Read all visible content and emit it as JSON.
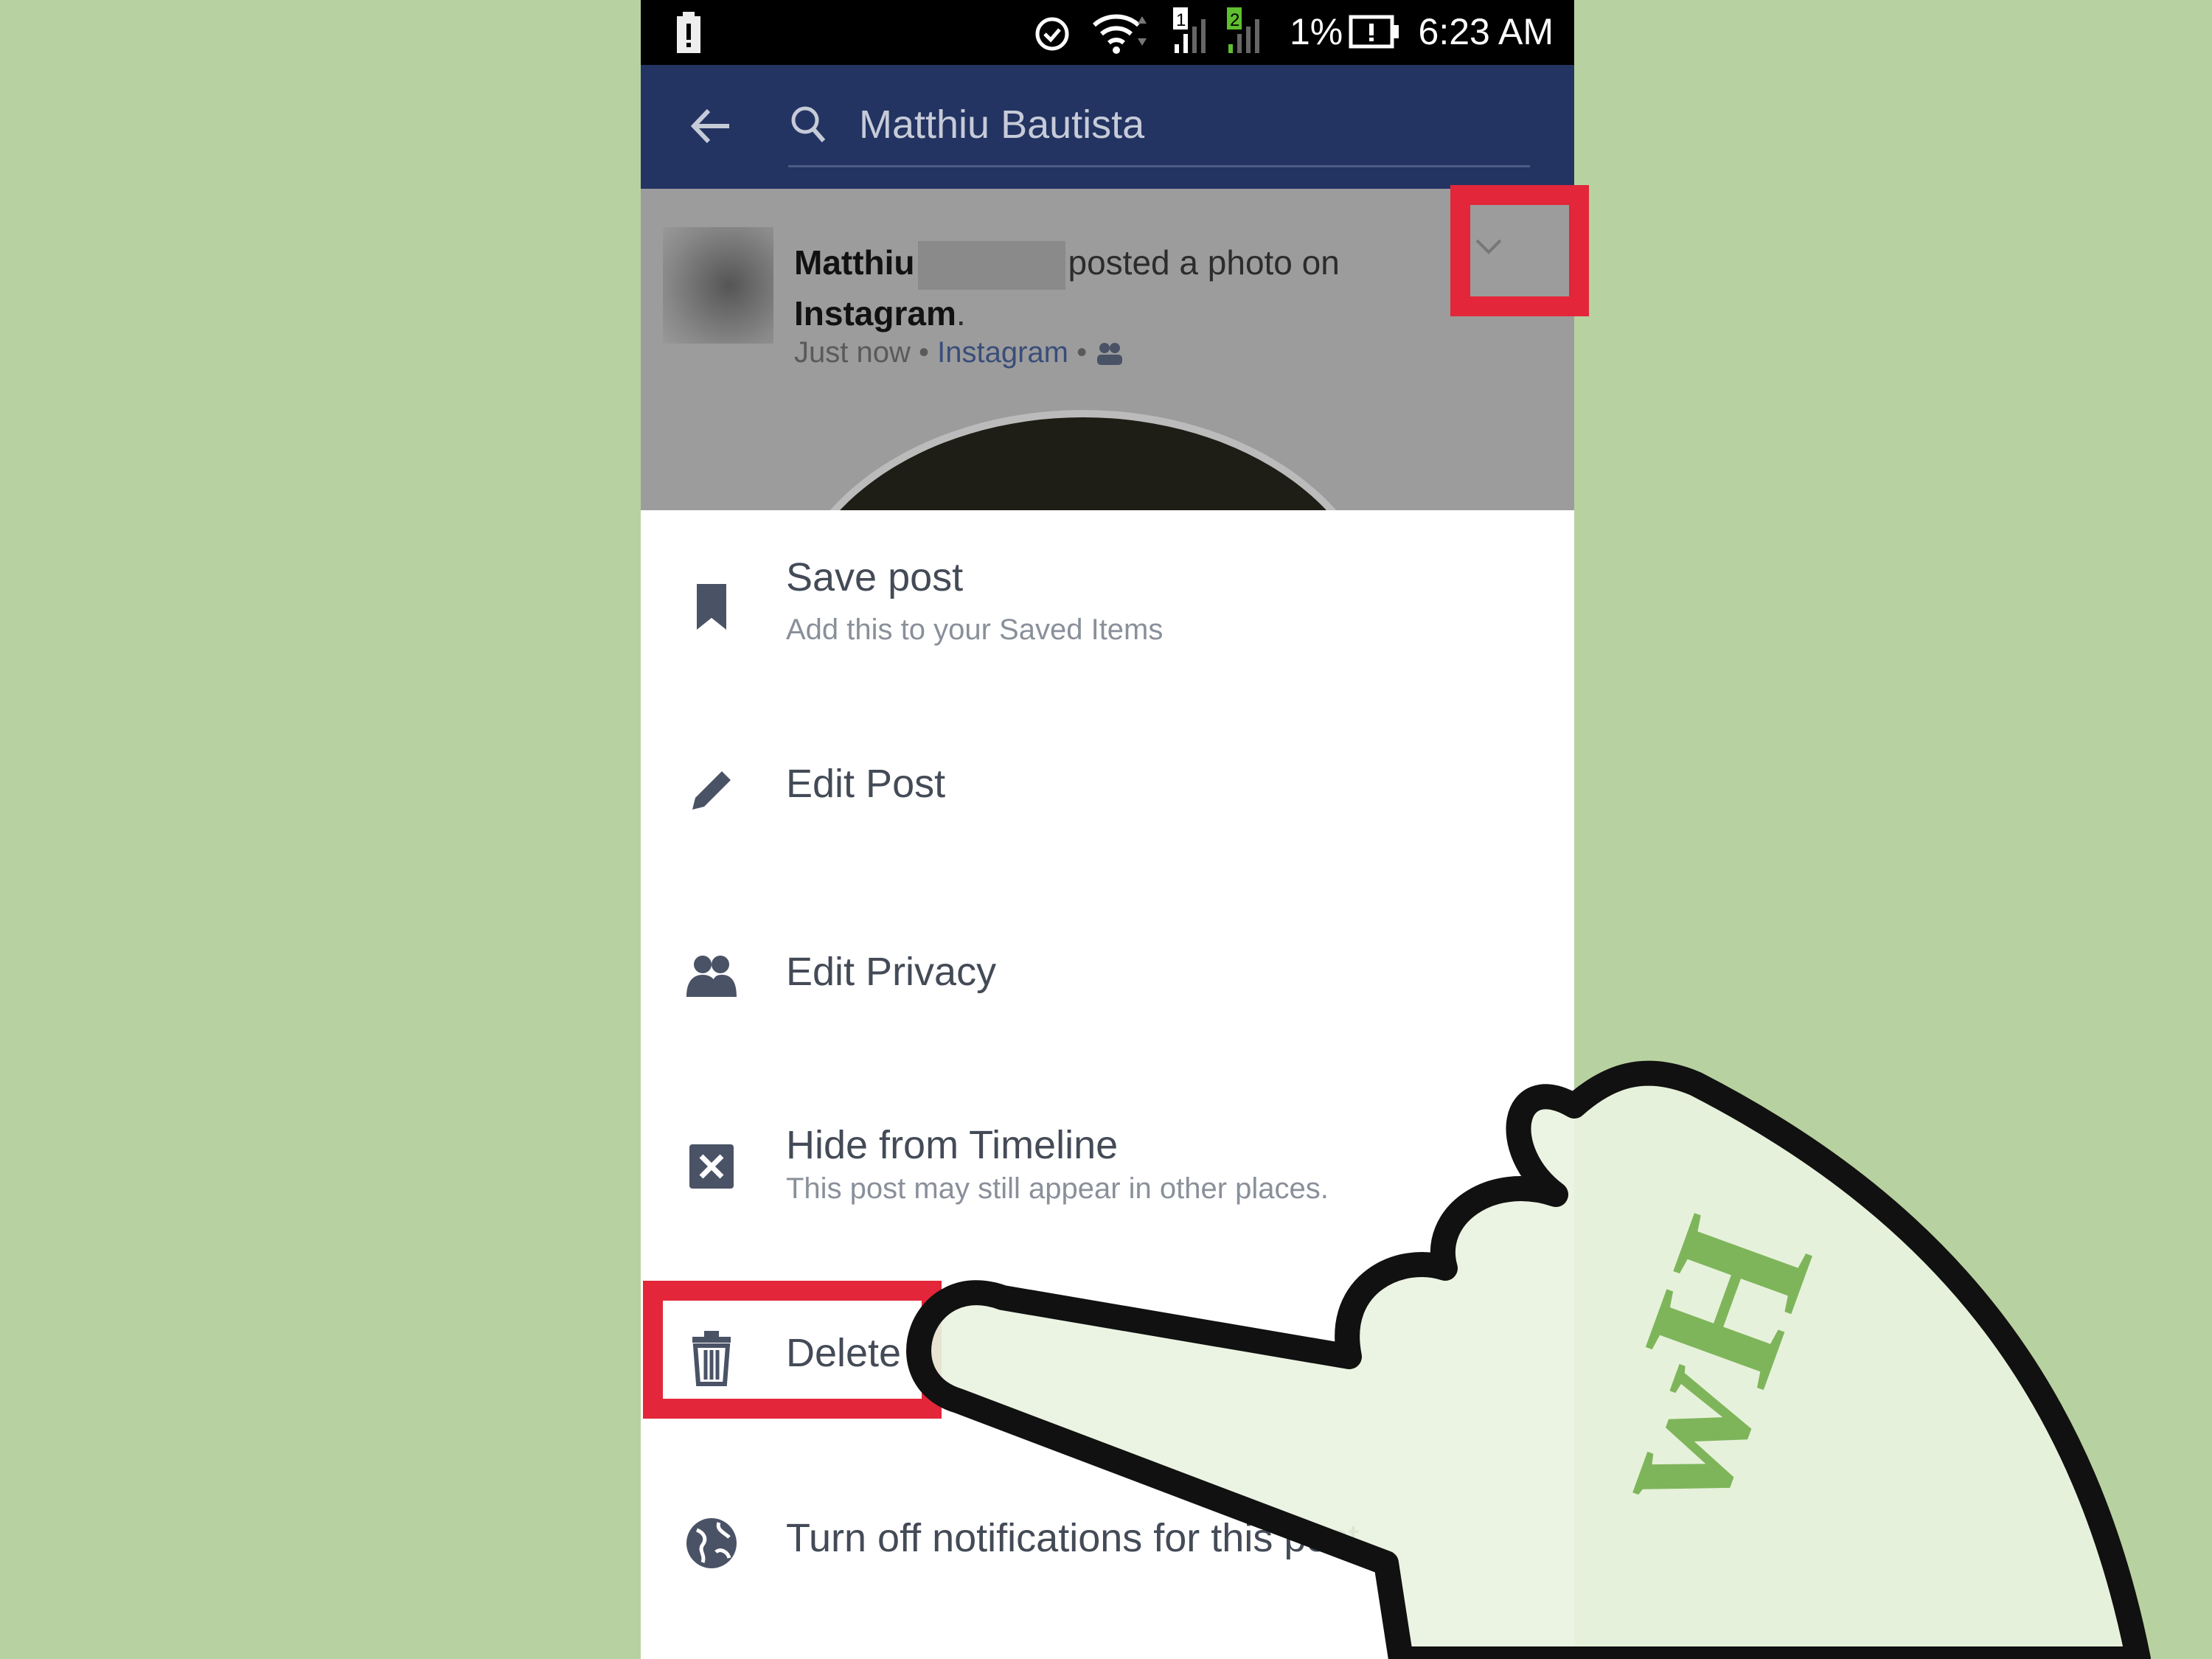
{
  "status_bar": {
    "battery_percent": "1%",
    "time": "6:23 AM",
    "sim1": "1",
    "sim2": "2"
  },
  "header": {
    "search_query": "Matthiu Bautista"
  },
  "post": {
    "author_first": "Matthiu",
    "action": "posted a photo on",
    "app": "Instagram",
    "timestamp": "Just now",
    "source": "Instagram",
    "separator": "•"
  },
  "menu": {
    "items": [
      {
        "title": "Save post",
        "subtitle": "Add this to your Saved Items",
        "icon": "bookmark-icon"
      },
      {
        "title": "Edit Post",
        "icon": "pencil-icon"
      },
      {
        "title": "Edit Privacy",
        "icon": "friends-icon"
      },
      {
        "title": "Hide from Timeline",
        "subtitle": "This post may still appear in other places.",
        "icon": "close-box-icon"
      },
      {
        "title": "Delete",
        "icon": "trash-icon"
      },
      {
        "title": "Turn off notifications for this post",
        "icon": "globe-icon"
      }
    ]
  },
  "colors": {
    "header": "#233462",
    "highlight": "#e3263a",
    "background": "#b8d1a0"
  },
  "logo": "wH"
}
